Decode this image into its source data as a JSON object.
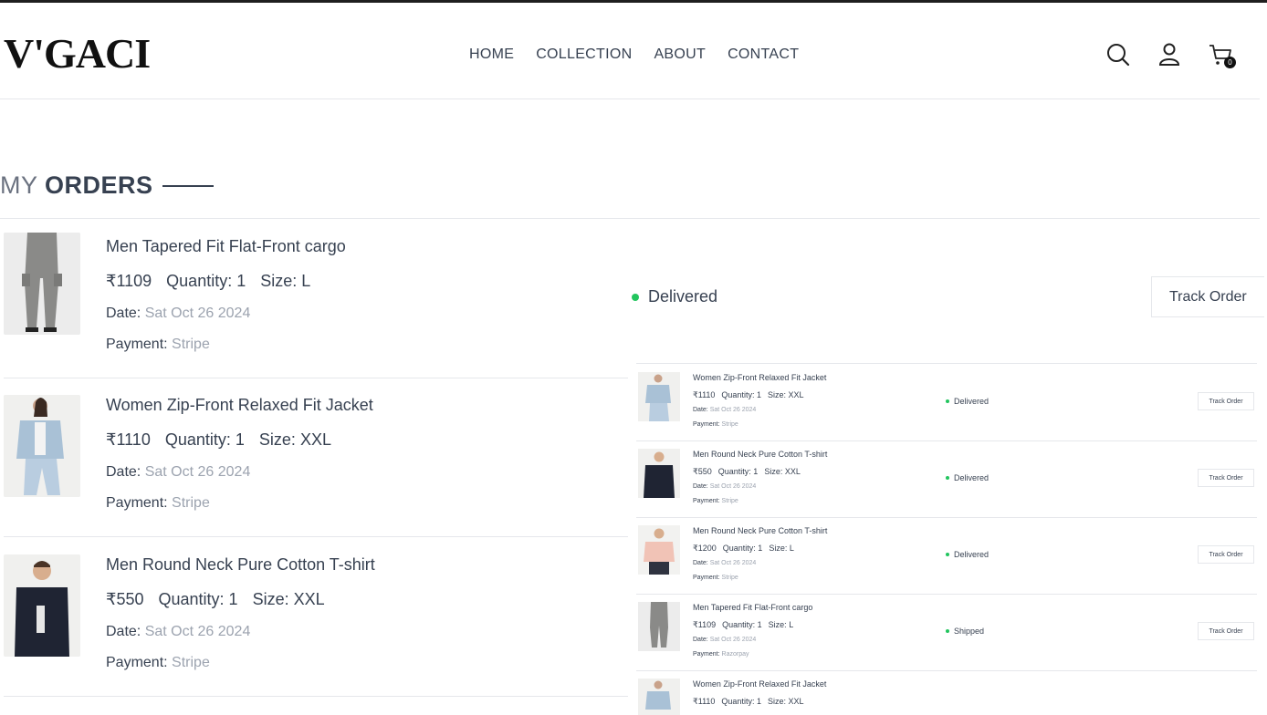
{
  "header": {
    "logo": "V'GACI",
    "nav": [
      "HOME",
      "COLLECTION",
      "ABOUT",
      "CONTACT"
    ],
    "cart_count": "0",
    "icons": [
      "search-icon",
      "user-icon",
      "cart-icon"
    ]
  },
  "page": {
    "title_prefix": "MY",
    "title_main": "ORDERS"
  },
  "labels": {
    "quantity": "Quantity:",
    "size": "Size:",
    "date": "Date:",
    "payment": "Payment:",
    "track_order": "Track Order"
  },
  "orders": [
    {
      "name": "Men Tapered Fit Flat-Front cargo",
      "price": "₹1109",
      "quantity": "1",
      "size": "L",
      "date": "Sat Oct 26 2024",
      "payment": "Stripe",
      "image": "cargo-pants"
    },
    {
      "name": "Women Zip-Front Relaxed Fit Jacket",
      "price": "₹1110",
      "quantity": "1",
      "size": "XXL",
      "date": "Sat Oct 26 2024",
      "payment": "Stripe",
      "image": "denim-jacket"
    },
    {
      "name": "Men Round Neck Pure Cotton T-shirt",
      "price": "₹550",
      "quantity": "1",
      "size": "XXL",
      "date": "Sat Oct 26 2024",
      "payment": "Stripe",
      "image": "navy-tshirt"
    }
  ],
  "first_status": "Delivered",
  "mini_orders": [
    {
      "name": "Women Zip-Front Relaxed Fit Jacket",
      "price": "₹1110",
      "quantity": "1",
      "size": "XXL",
      "date": "Sat Oct 26 2024",
      "payment": "Stripe",
      "status": "Delivered",
      "image": "denim-jacket"
    },
    {
      "name": "Men Round Neck Pure Cotton T-shirt",
      "price": "₹550",
      "quantity": "1",
      "size": "XXL",
      "date": "Sat Oct 26 2024",
      "payment": "Stripe",
      "status": "Delivered",
      "image": "navy-tshirt"
    },
    {
      "name": "Men Round Neck Pure Cotton T-shirt",
      "price": "₹1200",
      "quantity": "1",
      "size": "L",
      "date": "Sat Oct 26 2024",
      "payment": "Stripe",
      "status": "Delivered",
      "image": "pink-shirt"
    },
    {
      "name": "Men Tapered Fit Flat-Front cargo",
      "price": "₹1109",
      "quantity": "1",
      "size": "L",
      "date": "Sat Oct 26 2024",
      "payment": "Razorpay",
      "status": "Shipped",
      "image": "cargo-pants"
    },
    {
      "name": "Women Zip-Front Relaxed Fit Jacket",
      "price": "₹1110",
      "quantity": "1",
      "size": "XXL",
      "date": "",
      "payment": "",
      "status": "",
      "image": "denim-jacket"
    }
  ],
  "colors": {
    "status_green": "#22c55e",
    "text": "#374151",
    "muted": "#9ca3af",
    "border": "#e5e7eb"
  }
}
